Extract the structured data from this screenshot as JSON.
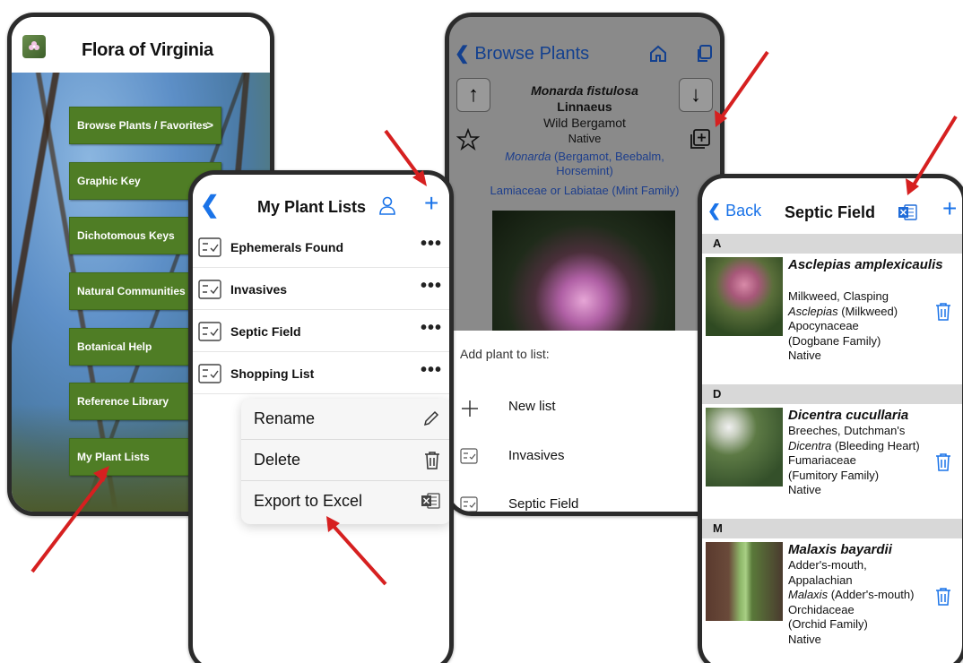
{
  "colors": {
    "accent_blue": "#1a73e8",
    "menu_green": "#4f7d25",
    "arrow_red": "#d62020",
    "excel_blue": "#1f6bd8"
  },
  "home": {
    "title": "Flora of Virginia",
    "menu": [
      {
        "label": "Browse Plants / Favorites",
        "chevron": ">"
      },
      {
        "label": "Graphic Key",
        "chevron": ""
      },
      {
        "label": "Dichotomous Keys",
        "chevron": ""
      },
      {
        "label": "Natural Communities",
        "chevron": ""
      },
      {
        "label": "Botanical Help",
        "chevron": ""
      },
      {
        "label": "Reference Library",
        "chevron": ""
      },
      {
        "label": "My Plant Lists",
        "chevron": ""
      }
    ]
  },
  "lists": {
    "title": "My Plant Lists",
    "items": [
      "Ephemerals Found",
      "Invasives",
      "Septic Field",
      "Shopping List"
    ],
    "more_label": "•••",
    "context_menu": [
      "Rename",
      "Delete",
      "Export to Excel"
    ]
  },
  "detail": {
    "back_label": "Browse Plants",
    "scientific_name": "Monarda fistulosa",
    "authority": "Linnaeus",
    "common_name": "Wild Bergamot",
    "status": "Native",
    "genus_italic": "Monarda",
    "genus_rest": " (Bergamot, Beebalm, Horsemint)",
    "family": "Lamiaceae or Labiatae (Mint Family)",
    "sheet_title": "Add plant to list:",
    "sheet_items": [
      "New list",
      "Invasives",
      "Septic Field"
    ]
  },
  "septic": {
    "back_label": "Back",
    "title": "Septic Field",
    "sections": [
      {
        "letter": "A",
        "sci": "Asclepias amplexicaulis",
        "common": "Milkweed, Clasping",
        "genus_italic": "Asclepias",
        "genus_rest": " (Milkweed)",
        "family": "Apocynaceae",
        "family_common": "(Dogbane Family)",
        "status": "Native"
      },
      {
        "letter": "D",
        "sci": "Dicentra cucullaria",
        "common": "Breeches, Dutchman's",
        "genus_italic": "Dicentra",
        "genus_rest": " (Bleeding Heart)",
        "family": "Fumariaceae",
        "family_common": "(Fumitory Family)",
        "status": "Native"
      },
      {
        "letter": "M",
        "sci": "Malaxis bayardii",
        "common": "Adder's-mouth,",
        "common2": "Appalachian",
        "genus_italic": "Malaxis",
        "genus_rest": " (Adder's-mouth)",
        "family": "Orchidaceae",
        "family_common": "(Orchid Family)",
        "status": "Native"
      }
    ]
  }
}
